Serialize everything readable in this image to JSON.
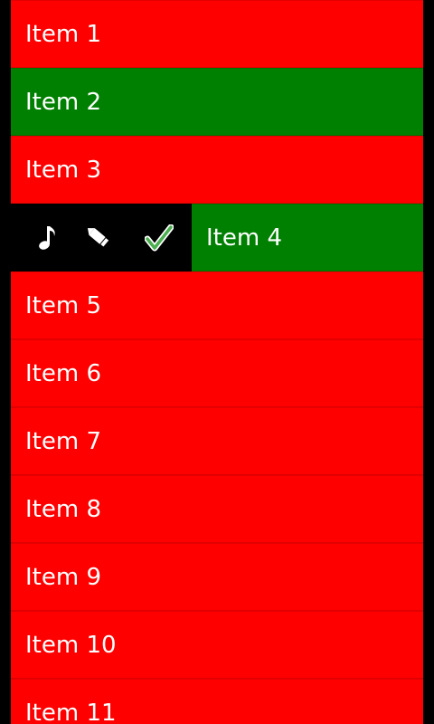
{
  "colors": {
    "background": "#000000",
    "item_default": "#ff0000",
    "item_selected": "#008000",
    "text": "#ffffff",
    "check_icon": "#4caf50"
  },
  "list": {
    "items": [
      {
        "label": "Item 1",
        "selected": false
      },
      {
        "label": "Item 2",
        "selected": true
      },
      {
        "label": "Item 3",
        "selected": false
      },
      {
        "label": "Item 4",
        "selected": true,
        "swiped": true
      },
      {
        "label": "Item 5",
        "selected": false
      },
      {
        "label": "Item 6",
        "selected": false
      },
      {
        "label": "Item 7",
        "selected": false
      },
      {
        "label": "Item 8",
        "selected": false
      },
      {
        "label": "Item 9",
        "selected": false
      },
      {
        "label": "Item 10",
        "selected": false
      },
      {
        "label": "Item 11",
        "selected": false
      }
    ],
    "swipe_actions": [
      {
        "icon": "music-note-icon"
      },
      {
        "icon": "pencil-icon"
      },
      {
        "icon": "check-icon"
      }
    ]
  }
}
